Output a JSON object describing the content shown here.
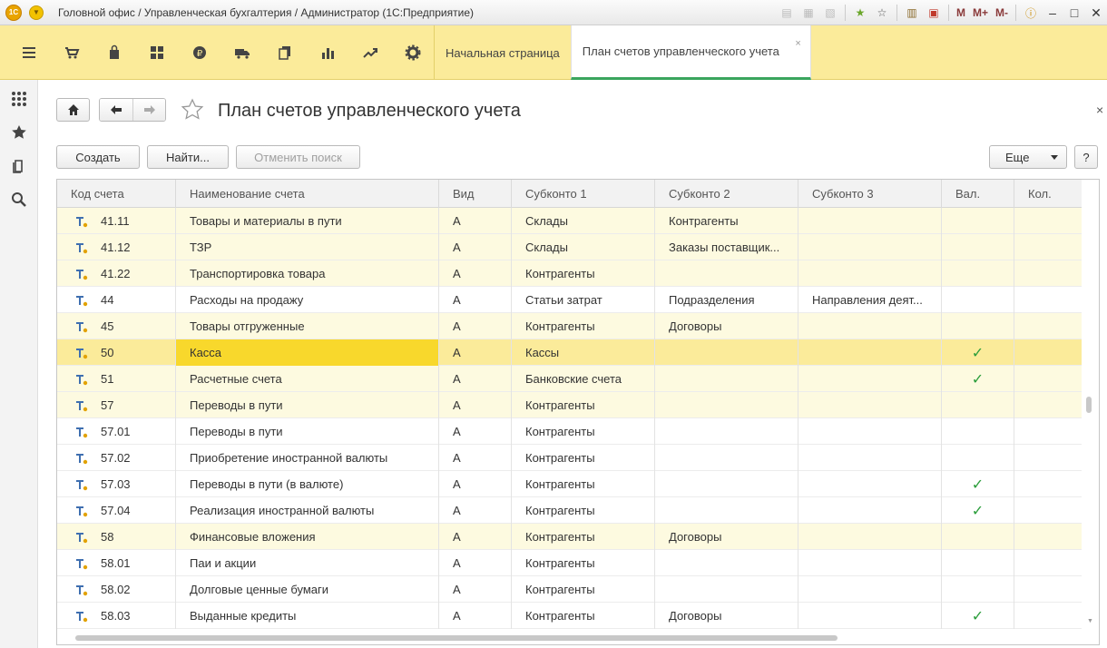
{
  "window": {
    "title": "Головной офис / Управленческая бухгалтерия / Администратор  (1С:Предприятие)",
    "logo_text": "1С",
    "m_buttons": [
      "M",
      "M+",
      "M-"
    ]
  },
  "sections": [
    "menu-icon",
    "cart-icon",
    "shopping-bag-icon",
    "dashboard-icon",
    "ruble-icon",
    "truck-icon",
    "documents-icon",
    "bar-chart-icon",
    "trend-icon",
    "gear-icon"
  ],
  "tabs": {
    "home": "Начальная страница",
    "active": "План счетов управленческого учета",
    "close": "×"
  },
  "form": {
    "title": "План счетов управленческого учета",
    "close": "×"
  },
  "commands": {
    "create": "Создать",
    "find": "Найти...",
    "cancel_search": "Отменить поиск",
    "more": "Еще",
    "help": "?"
  },
  "table": {
    "headers": [
      "Код счета",
      "Наименование счета",
      "Вид",
      "Субконто 1",
      "Субконто 2",
      "Субконто 3",
      "Вал.",
      "Кол."
    ],
    "rows": [
      {
        "code": "41.11",
        "name": "Товары и материалы в пути",
        "kind": "А",
        "s1": "Склады",
        "s2": "Контрагенты",
        "s3": "",
        "cur": false,
        "style": "hl"
      },
      {
        "code": "41.12",
        "name": "ТЗР",
        "kind": "А",
        "s1": "Склады",
        "s2": "Заказы поставщик...",
        "s3": "",
        "cur": false,
        "style": "hl"
      },
      {
        "code": "41.22",
        "name": "Транспортировка товара",
        "kind": "А",
        "s1": "Контрагенты",
        "s2": "",
        "s3": "",
        "cur": false,
        "style": "hl"
      },
      {
        "code": "44",
        "name": "Расходы на продажу",
        "kind": "А",
        "s1": "Статьи затрат",
        "s2": "Подразделения",
        "s3": "Направления деят...",
        "cur": false,
        "style": ""
      },
      {
        "code": "45",
        "name": "Товары отгруженные",
        "kind": "А",
        "s1": "Контрагенты",
        "s2": "Договоры",
        "s3": "",
        "cur": false,
        "style": "hl"
      },
      {
        "code": "50",
        "name": "Касса",
        "kind": "А",
        "s1": "Кассы",
        "s2": "",
        "s3": "",
        "cur": true,
        "style": "sel"
      },
      {
        "code": "51",
        "name": "Расчетные счета",
        "kind": "А",
        "s1": "Банковские счета",
        "s2": "",
        "s3": "",
        "cur": true,
        "style": "hl"
      },
      {
        "code": "57",
        "name": "Переводы в пути",
        "kind": "А",
        "s1": "Контрагенты",
        "s2": "",
        "s3": "",
        "cur": false,
        "style": "hl"
      },
      {
        "code": "57.01",
        "name": "Переводы в пути",
        "kind": "А",
        "s1": "Контрагенты",
        "s2": "",
        "s3": "",
        "cur": false,
        "style": ""
      },
      {
        "code": "57.02",
        "name": "Приобретение иностранной валюты",
        "kind": "А",
        "s1": "Контрагенты",
        "s2": "",
        "s3": "",
        "cur": false,
        "style": ""
      },
      {
        "code": "57.03",
        "name": "Переводы в пути (в валюте)",
        "kind": "А",
        "s1": "Контрагенты",
        "s2": "",
        "s3": "",
        "cur": true,
        "style": ""
      },
      {
        "code": "57.04",
        "name": "Реализация иностранной валюты",
        "kind": "А",
        "s1": "Контрагенты",
        "s2": "",
        "s3": "",
        "cur": true,
        "style": ""
      },
      {
        "code": "58",
        "name": "Финансовые вложения",
        "kind": "А",
        "s1": "Контрагенты",
        "s2": "Договоры",
        "s3": "",
        "cur": false,
        "style": "hl"
      },
      {
        "code": "58.01",
        "name": "Паи и акции",
        "kind": "А",
        "s1": "Контрагенты",
        "s2": "",
        "s3": "",
        "cur": false,
        "style": ""
      },
      {
        "code": "58.02",
        "name": "Долговые ценные бумаги",
        "kind": "А",
        "s1": "Контрагенты",
        "s2": "",
        "s3": "",
        "cur": false,
        "style": ""
      },
      {
        "code": "58.03",
        "name": "Выданные кредиты",
        "kind": "А",
        "s1": "Контрагенты",
        "s2": "Договоры",
        "s3": "",
        "cur": true,
        "style": ""
      }
    ],
    "check_mark": "✓"
  },
  "colors": {
    "accent_yellow": "#fbeb9a",
    "selected_cell": "#f8d82c",
    "row_highlight": "#fdfae0",
    "active_tab_underline": "#3aa55d",
    "check_green": "#2a9d3a"
  }
}
